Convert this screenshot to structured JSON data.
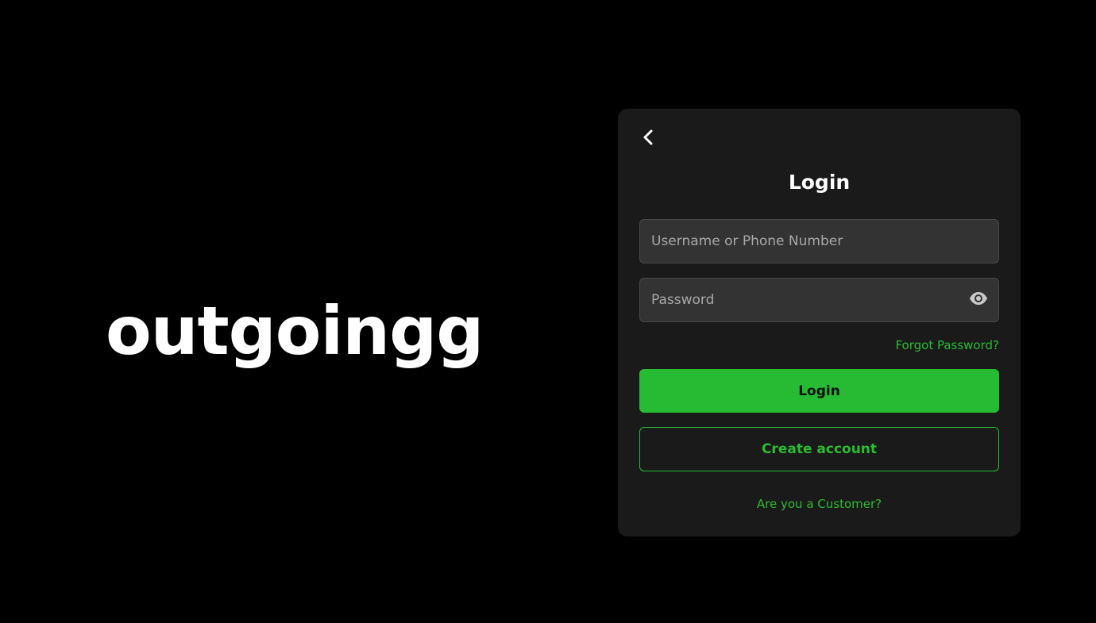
{
  "brand": {
    "name": "outgoingg"
  },
  "login_card": {
    "title": "Login",
    "back_icon": "chevron-left-icon",
    "username": {
      "placeholder": "Username or Phone Number",
      "value": ""
    },
    "password": {
      "placeholder": "Password",
      "value": "",
      "toggle_icon": "eye-icon"
    },
    "forgot_password": "Forgot Password?",
    "login_button": "Login",
    "create_account_button": "Create account",
    "customer_link": "Are you a Customer?"
  },
  "colors": {
    "background": "#000000",
    "card": "#1a1a1a",
    "input": "#333333",
    "accent": "#27bb33",
    "text": "#ffffff"
  }
}
